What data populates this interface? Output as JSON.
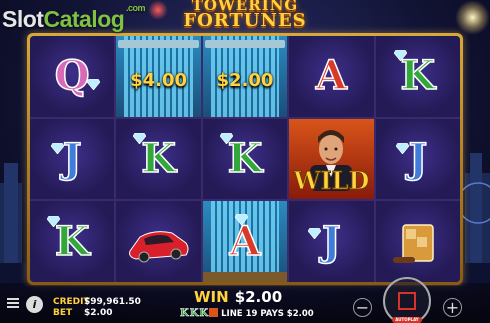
{
  "watermark": {
    "slot": "Slot",
    "catalog": "Catalog",
    "com": ".com"
  },
  "game_title": {
    "line1": "TOWERING",
    "line2": "FORTUNES"
  },
  "reels": [
    [
      "Q",
      "J",
      "K"
    ],
    [
      "tower",
      "K",
      "sports-car"
    ],
    [
      "tower",
      "K",
      "A"
    ],
    [
      "A",
      "wild",
      "J"
    ],
    [
      "K",
      "J",
      "whiskey"
    ]
  ],
  "cash_values": {
    "reel2": "$4.00",
    "reel3": "$2.00"
  },
  "wild_label": "WILD",
  "meters": {
    "credit_label": "CREDIT",
    "credit_value": "$99,961.50",
    "bet_label": "BET",
    "bet_value": "$2.00"
  },
  "win": {
    "label": "WIN",
    "value": "$2.00"
  },
  "line_pay": "LINE 19 PAYS $2.00",
  "line_pay_symbols": [
    "K",
    "K",
    "K",
    "wild"
  ],
  "buttons": {
    "minus": "−",
    "plus": "+",
    "info": "i",
    "autoplay": "AUTOPLAY"
  },
  "colors": {
    "gold": "#ffd23e",
    "frame": "#d8a83a",
    "spin_accent": "#d8322a",
    "Q": "#d86ab8",
    "J": "#3f7dd8",
    "K": "#33a83a",
    "A": "#d83a2a"
  }
}
